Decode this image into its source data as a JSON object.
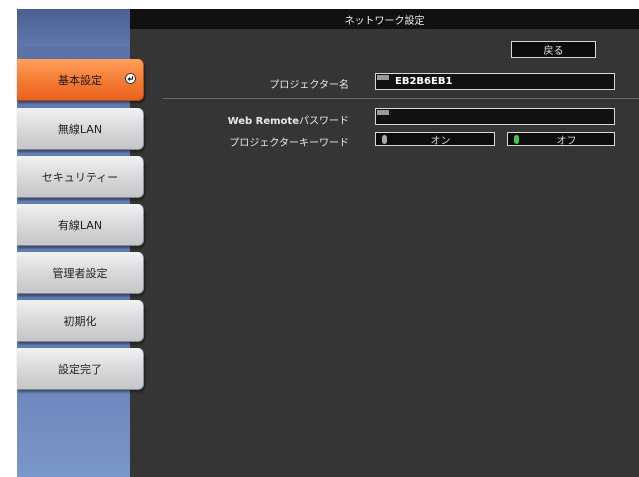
{
  "titlebar": {
    "title": "ネットワーク設定"
  },
  "back_button": {
    "label": "戻る"
  },
  "sidebar": {
    "items": [
      {
        "label": "基本設定"
      },
      {
        "label": "無線LAN"
      },
      {
        "label": "セキュリティー"
      },
      {
        "label": "有線LAN"
      },
      {
        "label": "管理者設定"
      },
      {
        "label": "初期化"
      },
      {
        "label": "設定完了"
      }
    ],
    "active_index": 0
  },
  "form": {
    "projector_name": {
      "label": "プロジェクター名",
      "value": "EB2B6EB1"
    },
    "web_remote_password": {
      "label_bold": "Web Remote",
      "label_rest": "パスワード",
      "value": ""
    },
    "projector_keyword": {
      "label": "プロジェクターキーワード",
      "options": [
        {
          "label": "オン",
          "selected": false
        },
        {
          "label": "オフ",
          "selected": true
        }
      ]
    }
  },
  "colors": {
    "active_menu": "#f47a32",
    "led_on": "#47c24a",
    "led_off": "#a8a8a8"
  }
}
